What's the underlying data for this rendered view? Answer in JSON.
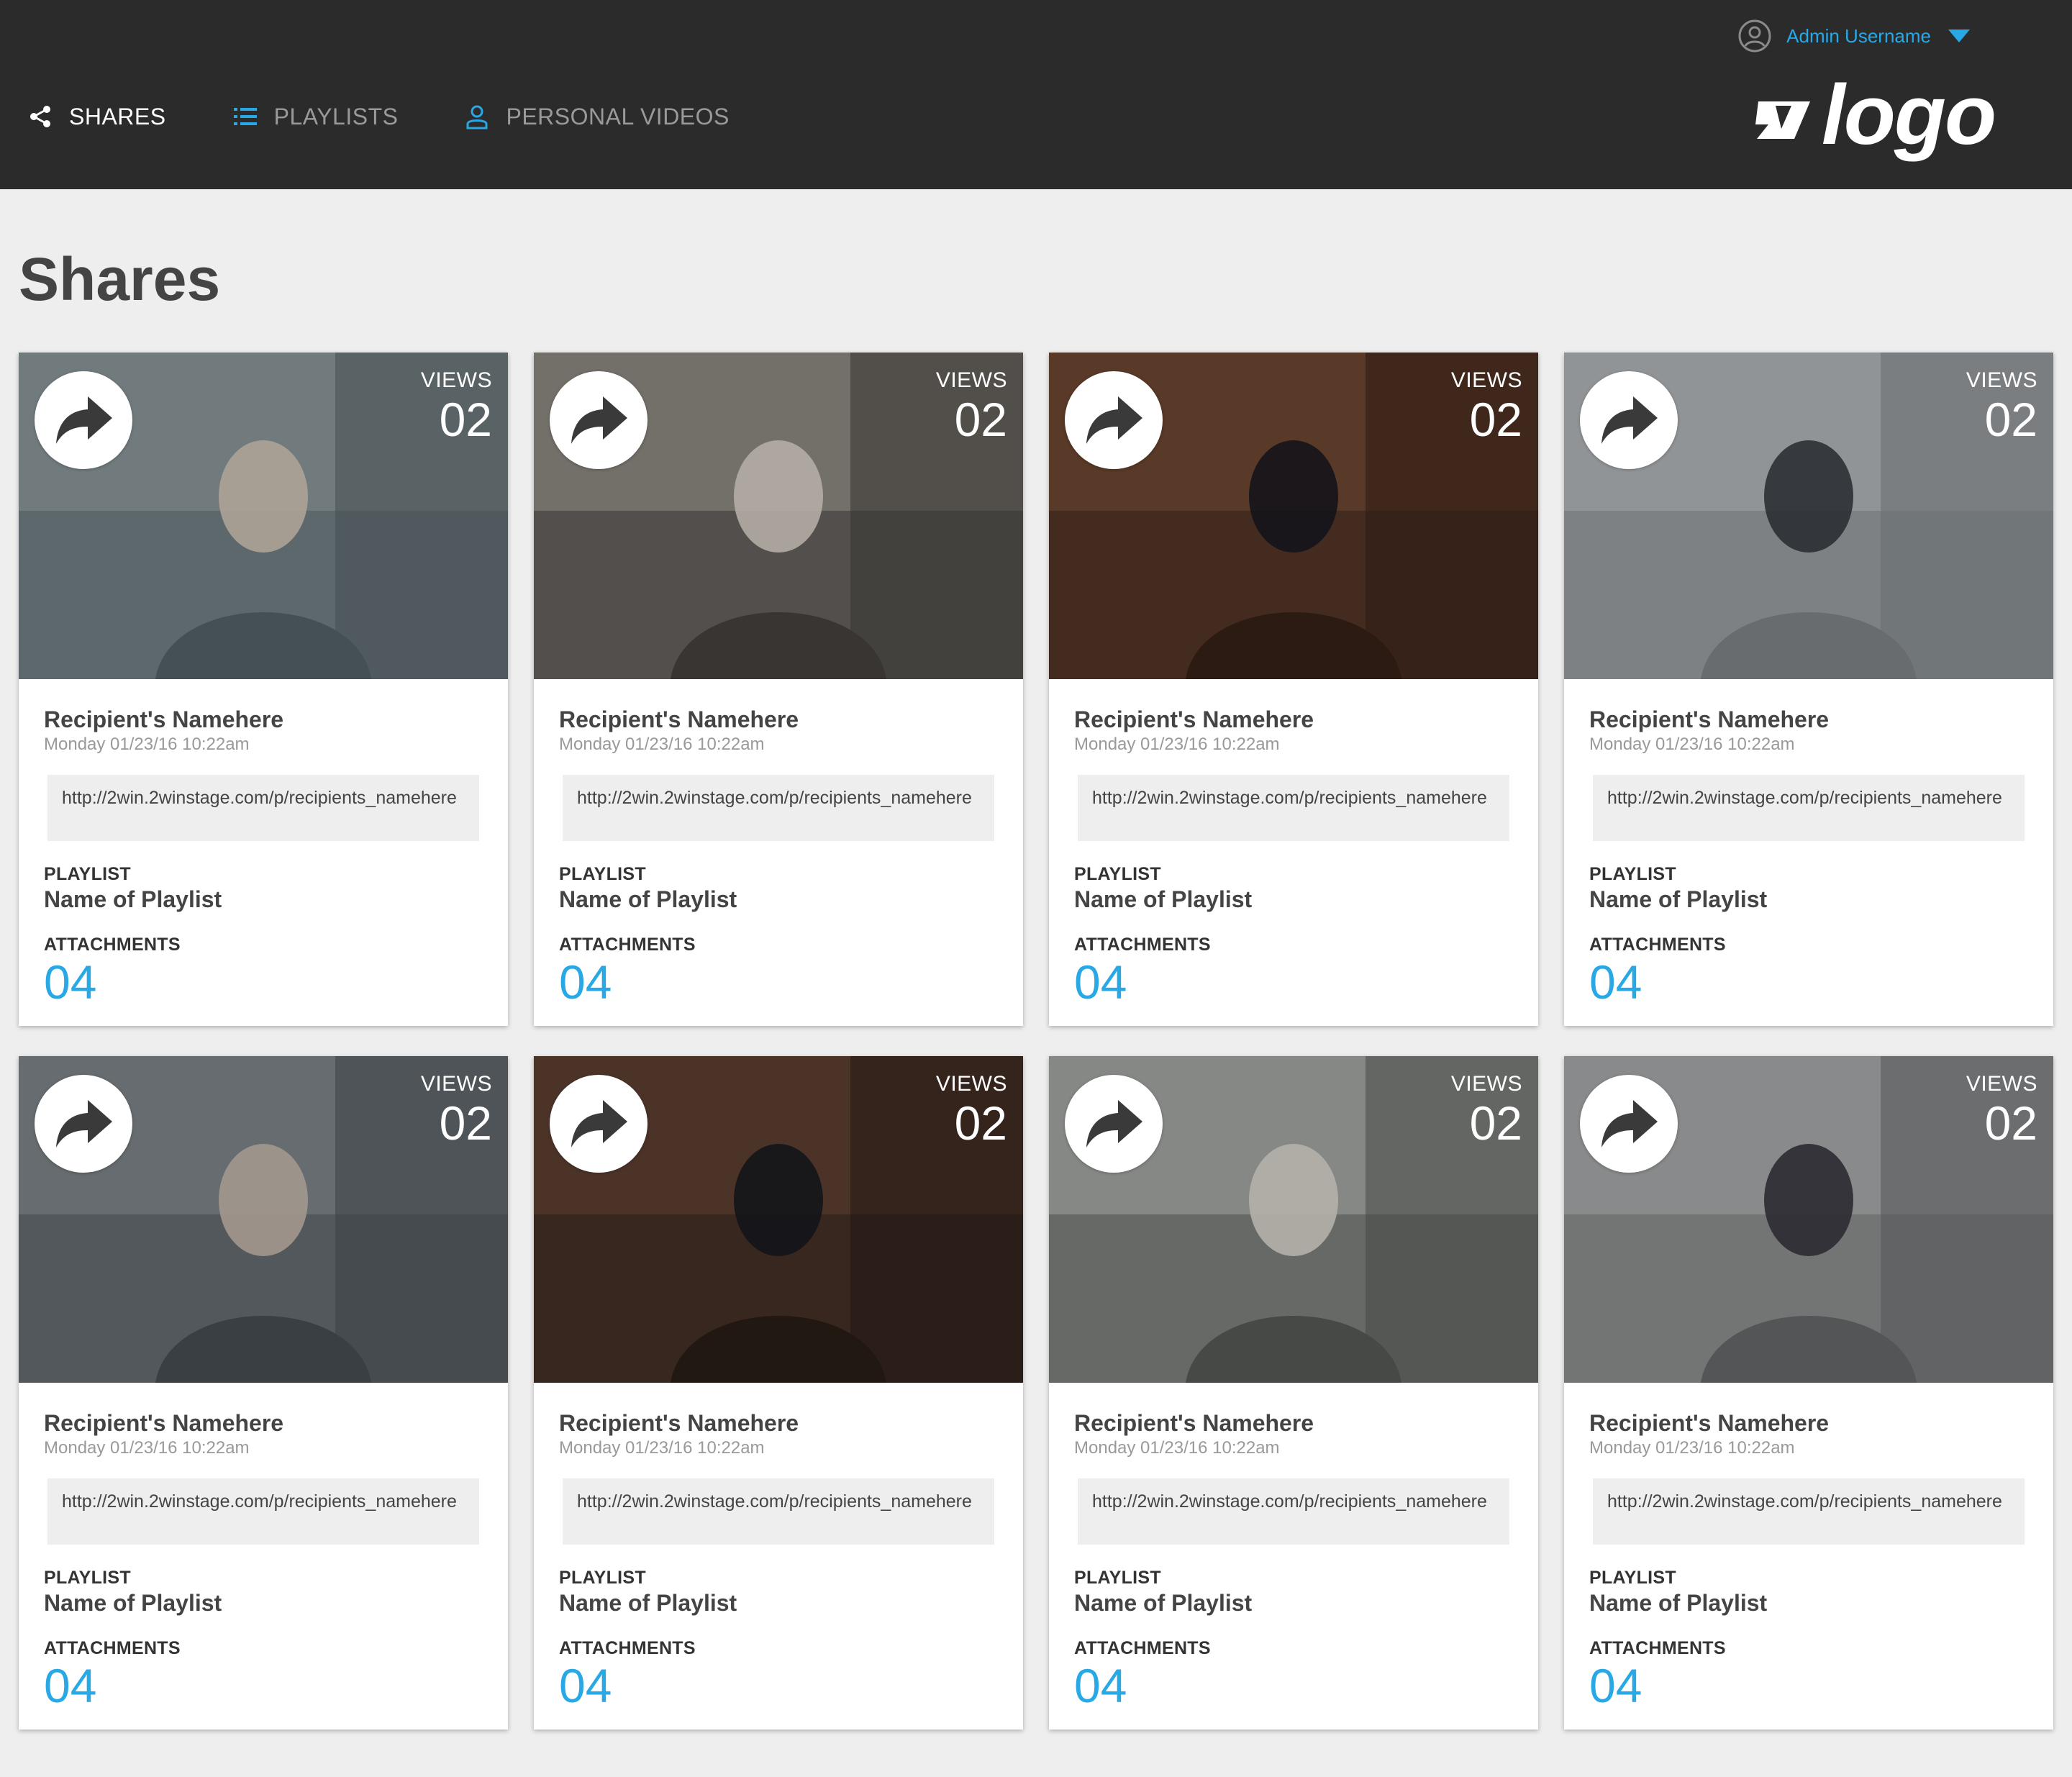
{
  "header": {
    "username": "Admin Username",
    "logo_text": "logo",
    "nav": [
      {
        "label": "SHARES",
        "icon": "share-icon",
        "active": true
      },
      {
        "label": "PLAYLISTS",
        "icon": "list-icon",
        "active": false
      },
      {
        "label": "PERSONAL VIDEOS",
        "icon": "person-icon",
        "active": false
      }
    ]
  },
  "page": {
    "title": "Shares"
  },
  "labels": {
    "views": "VIEWS",
    "playlist": "PLAYLIST",
    "attachments": "ATTACHMENTS"
  },
  "colors": {
    "accent": "#29a8e6",
    "header_bg": "#2b2b2b",
    "page_bg": "#eeeeee"
  },
  "cards": [
    {
      "name": "Recipient's Namehere",
      "date": "Monday 01/23/16 10:22am",
      "link": "http://2win.2winstage.com/p/recipients_namehere",
      "playlist": "Name of Playlist",
      "attachments": "04",
      "views": "02"
    },
    {
      "name": "Recipient's Namehere",
      "date": "Monday 01/23/16 10:22am",
      "link": "http://2win.2winstage.com/p/recipients_namehere",
      "playlist": "Name of Playlist",
      "attachments": "04",
      "views": "02"
    },
    {
      "name": "Recipient's Namehere",
      "date": "Monday 01/23/16 10:22am",
      "link": "http://2win.2winstage.com/p/recipients_namehere",
      "playlist": "Name of Playlist",
      "attachments": "04",
      "views": "02"
    },
    {
      "name": "Recipient's Namehere",
      "date": "Monday 01/23/16 10:22am",
      "link": "http://2win.2winstage.com/p/recipients_namehere",
      "playlist": "Name of Playlist",
      "attachments": "04",
      "views": "02"
    },
    {
      "name": "Recipient's Namehere",
      "date": "Monday 01/23/16 10:22am",
      "link": "http://2win.2winstage.com/p/recipients_namehere",
      "playlist": "Name of Playlist",
      "attachments": "04",
      "views": "02"
    },
    {
      "name": "Recipient's Namehere",
      "date": "Monday 01/23/16 10:22am",
      "link": "http://2win.2winstage.com/p/recipients_namehere",
      "playlist": "Name of Playlist",
      "attachments": "04",
      "views": "02"
    },
    {
      "name": "Recipient's Namehere",
      "date": "Monday 01/23/16 10:22am",
      "link": "http://2win.2winstage.com/p/recipients_namehere",
      "playlist": "Name of Playlist",
      "attachments": "04",
      "views": "02"
    },
    {
      "name": "Recipient's Namehere",
      "date": "Monday 01/23/16 10:22am",
      "link": "http://2win.2winstage.com/p/recipients_namehere",
      "playlist": "Name of Playlist",
      "attachments": "04",
      "views": "02"
    }
  ]
}
